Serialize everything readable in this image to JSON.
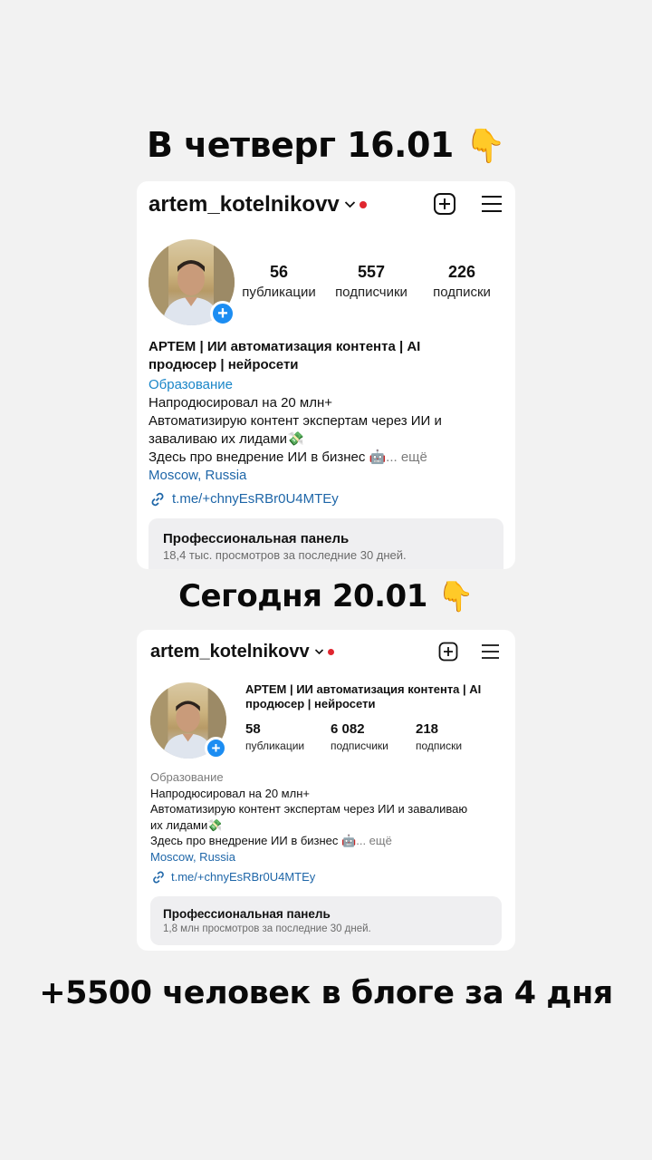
{
  "headlines": {
    "first": "В четверг 16.01",
    "second": "Сегодня 20.01",
    "bottom": "+5500 человек в блоге за 4 дня",
    "pointer": "👇"
  },
  "before": {
    "username": "artem_kotelnikovv",
    "stats": [
      {
        "value": "56",
        "label": "публикации"
      },
      {
        "value": "557",
        "label": "подписчики"
      },
      {
        "value": "226",
        "label": "подписки"
      }
    ],
    "name_line1": "АРТЕМ | ИИ автоматизация контента | AI",
    "name_line2": "продюсер | нейросети",
    "category": "Образование",
    "bio_line1": "Напродюсировал на 20 млн+",
    "bio_line2": "Автоматизирую контент экспертам через ИИ и",
    "bio_line3": "заваливаю их лидами💸",
    "bio_line4": "Здесь про внедрение ИИ в бизнес 🤖",
    "more": "... ещё",
    "location": "Moscow, Russia",
    "link": "t.me/+chnyEsRBr0U4MTEy",
    "panel_title": "Профессиональная панель",
    "panel_subtitle": "18,4 тыс. просмотров за последние 30 дней."
  },
  "after": {
    "username": "artem_kotelnikovv",
    "name_line1": "АРТЕМ | ИИ автоматизация контента | AI",
    "name_line2": "продюсер | нейросети",
    "stats": [
      {
        "value": "58",
        "label": "публикации"
      },
      {
        "value": "6 082",
        "label": "подписчики"
      },
      {
        "value": "218",
        "label": "подписки"
      }
    ],
    "category": "Образование",
    "bio_line1": "Напродюсировал на 20 млн+",
    "bio_line2": "Автоматизирую контент экспертам через ИИ и заваливаю",
    "bio_line3": "их лидами💸",
    "bio_line4": "Здесь про внедрение ИИ в бизнес 🤖",
    "more": "... ещё",
    "location": "Moscow, Russia",
    "link": "t.me/+chnyEsRBr0U4MTEy",
    "panel_title": "Профессиональная панель",
    "panel_subtitle": "1,8 млн просмотров за последние 30 дней."
  },
  "colors": {
    "background": "#f2f2f2",
    "link": "#1e66a8",
    "category": "#1a86c8",
    "notification_dot": "#e0262f",
    "add_story_badge": "#1c8df2"
  },
  "icons": [
    "chevron-down-icon",
    "new-post-plus-icon",
    "hamburger-menu-icon",
    "link-icon",
    "add-story-plus-icon"
  ]
}
